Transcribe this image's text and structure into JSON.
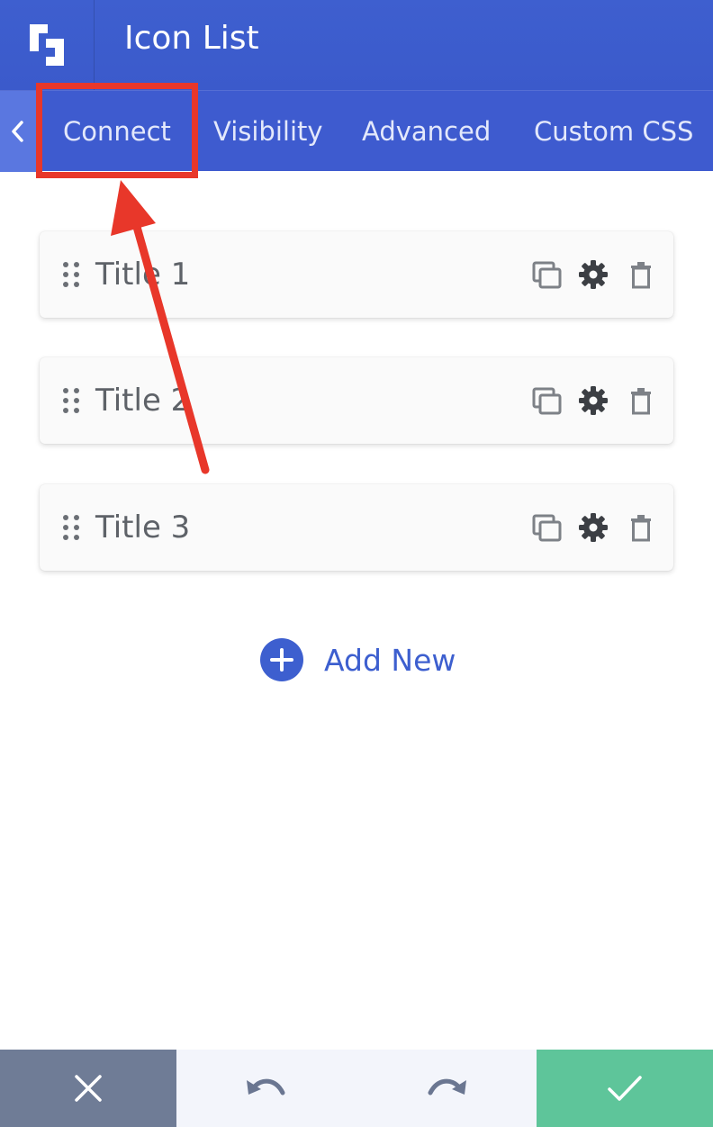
{
  "header": {
    "title": "Icon List",
    "logo_icon": "beaver-builder-logo-icon"
  },
  "tabs": {
    "back_icon": "chevron-left-icon",
    "items": [
      {
        "label": "Connect",
        "highlighted": true
      },
      {
        "label": "Visibility"
      },
      {
        "label": "Advanced"
      },
      {
        "label": "Custom CSS"
      }
    ]
  },
  "list": {
    "items": [
      {
        "title": "Title 1"
      },
      {
        "title": "Title 2"
      },
      {
        "title": "Title 3"
      }
    ],
    "actions": [
      "duplicate-icon",
      "gear-icon",
      "trash-icon"
    ]
  },
  "add_new": {
    "label": "Add New",
    "icon": "plus-circle-icon"
  },
  "footer": {
    "buttons": [
      {
        "name": "cancel",
        "icon": "close-icon",
        "color": "#6f7c96"
      },
      {
        "name": "undo",
        "icon": "undo-icon",
        "color": "#f3f5fb"
      },
      {
        "name": "redo",
        "icon": "redo-icon",
        "color": "#f3f5fb"
      },
      {
        "name": "save",
        "icon": "check-icon",
        "color": "#5ec59a"
      }
    ]
  },
  "colors": {
    "header": "#3b5acb",
    "accent": "#3d5fcf",
    "annotation": "#e8372a"
  }
}
